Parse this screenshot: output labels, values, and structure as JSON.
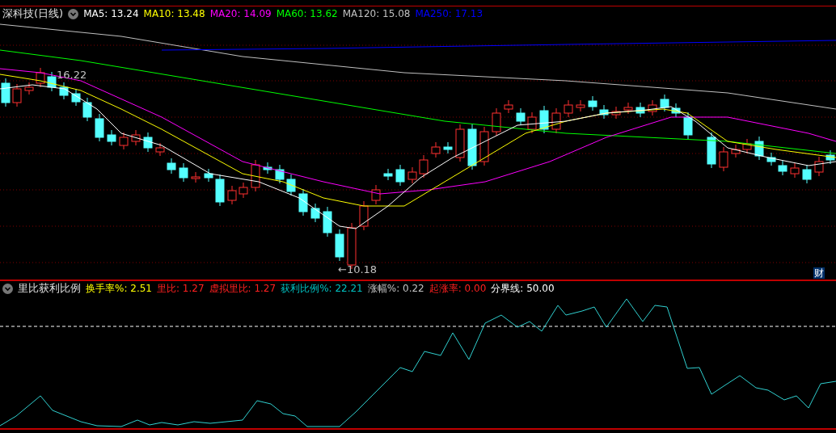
{
  "chart_header": {
    "title": "深科技(日线)",
    "indicators": [
      {
        "label": "MA5:",
        "value": "13.24",
        "color": "#ffffff"
      },
      {
        "label": "MA10:",
        "value": "13.48",
        "color": "#ffff00"
      },
      {
        "label": "MA20:",
        "value": "14.09",
        "color": "#ff00ff"
      },
      {
        "label": "MA60:",
        "value": "13.62",
        "color": "#00ff00"
      },
      {
        "label": "MA120:",
        "value": "15.08",
        "color": "#c0c0c0"
      },
      {
        "label": "MA250:",
        "value": "17.13",
        "color": "#0000ff"
      }
    ]
  },
  "price_chart": {
    "high_label": "16.22",
    "low_label": "←10.18",
    "badge": "财"
  },
  "indicator_header": {
    "title": "里比获利比例",
    "indicators": [
      {
        "label": "换手率%:",
        "value": "2.51",
        "color": "#ffff00"
      },
      {
        "label": "里比:",
        "value": "1.27",
        "color": "#ff2020"
      },
      {
        "label": "虚拟里比:",
        "value": "1.27",
        "color": "#ff2020"
      },
      {
        "label": "获利比例%:",
        "value": "22.21",
        "color": "#00c0c0"
      },
      {
        "label": "涨幅%:",
        "value": "0.22",
        "color": "#c0c0c0"
      },
      {
        "label": "起涨率:",
        "value": "0.00",
        "color": "#ff2020"
      },
      {
        "label": "分界线:",
        "value": "50.00",
        "color": "#ffffff"
      }
    ]
  }
}
